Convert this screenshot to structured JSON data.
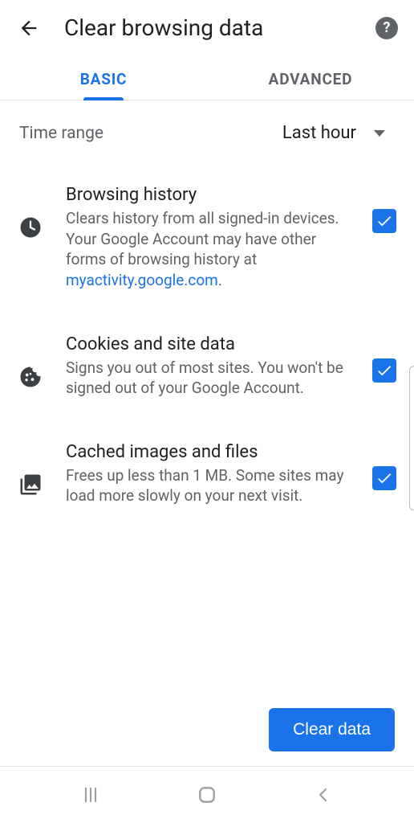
{
  "header": {
    "title": "Clear browsing data"
  },
  "tabs": {
    "basic": "BASIC",
    "advanced": "ADVANCED"
  },
  "time_range": {
    "label": "Time range",
    "value": "Last hour"
  },
  "options": [
    {
      "title": "Browsing history",
      "desc_before": "Clears history from all signed-in devices. Your Google Account may have other forms of browsing history at ",
      "desc_link": "myactivity.google.com",
      "desc_after": ".",
      "checked": true
    },
    {
      "title": "Cookies and site data",
      "desc_before": "Signs you out of most sites. You won't be signed out of your Google Account.",
      "desc_link": "",
      "desc_after": "",
      "checked": true
    },
    {
      "title": "Cached images and files",
      "desc_before": "Frees up less than 1 MB. Some sites may load more slowly on your next visit.",
      "desc_link": "",
      "desc_after": "",
      "checked": true
    }
  ],
  "footer": {
    "clear_button": "Clear data"
  }
}
